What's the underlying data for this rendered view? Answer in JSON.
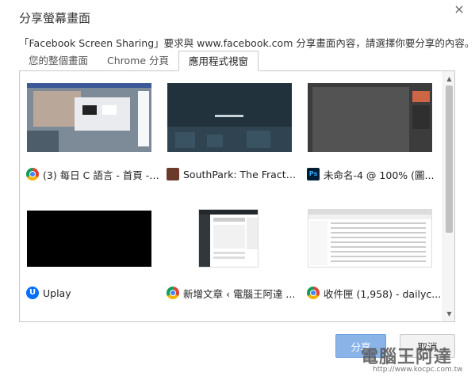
{
  "dialog": {
    "title": "分享螢幕畫面",
    "close": "×",
    "description": "「Facebook Screen Sharing」要求與 www.facebook.com 分享畫面內容，請選擇你要分享的內容。"
  },
  "tabs": [
    {
      "label": "您的整個畫面",
      "active": false
    },
    {
      "label": "Chrome 分頁",
      "active": false
    },
    {
      "label": "應用程式視窗",
      "active": true
    }
  ],
  "windows": [
    {
      "label": "(3) 每日 C 語言 - 首頁 - ...",
      "icon": "chrome-icon"
    },
    {
      "label": "SouthPark: The Fractur...",
      "icon": "southpark-icon"
    },
    {
      "label": "未命名-4 @ 100% (圖...",
      "icon": "photoshop-icon",
      "icon_text": "Ps"
    },
    {
      "label": "Uplay",
      "icon": "uplay-icon",
      "icon_text": "U"
    },
    {
      "label": "新增文章 ‹ 電腦王阿達 ...",
      "icon": "chrome-icon"
    },
    {
      "label": "收件匣 (1,958) - dailyc...",
      "icon": "chrome-icon"
    }
  ],
  "scrollbar": {
    "up": "▲",
    "down": "▼"
  },
  "footer": {
    "share_label": "分享",
    "cancel_label": "取消",
    "watermark": "電腦王阿達",
    "watermark_url": "http://www.kocpc.com.tw"
  }
}
